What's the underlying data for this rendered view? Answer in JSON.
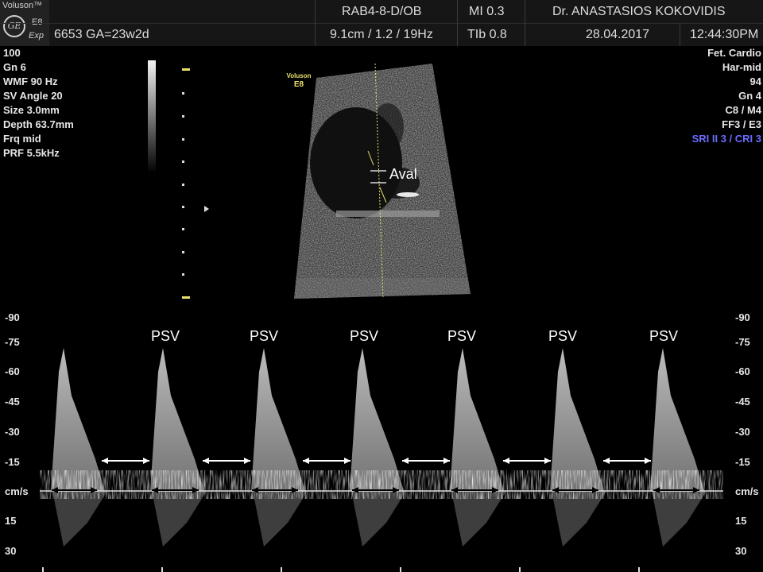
{
  "header": {
    "brand": "Voluson™",
    "model": "E8",
    "mode": "Exp",
    "probe": "RAB4-8-D/OB",
    "mi": "MI  0.3",
    "doctor": "Dr. ANASTASIOS KOKOVIDIS",
    "patient": "6653  GA=23w2d",
    "depth_freq": "9.1cm / 1.2 / 19Hz",
    "tib": "TIb  0.8",
    "date": "28.04.2017",
    "time": "12:44:30PM"
  },
  "left_params": [
    "100",
    "Gn  6",
    "WMF 90 Hz",
    "SV Angle 20",
    "Size  3.0mm",
    "Depth 63.7mm",
    "Frq mid",
    "PRF  5.5kHz"
  ],
  "right_params": [
    "Fet. Cardio",
    "Har-mid",
    "94",
    "Gn  4",
    "C8 / M4",
    "FF3 / E3"
  ],
  "right_params_highlight": "SRI II 3 / CRI 3",
  "image_labels": {
    "voluson_tag_1": "Voluson",
    "voluson_tag_2": "E8",
    "annotation": "Aval"
  },
  "spectrum": {
    "scale_labels": [
      "-90",
      "-75",
      "-60",
      "-45",
      "-30",
      "-15",
      "cm/s",
      "15",
      "30"
    ],
    "peak_label": "PSV",
    "peak_count": 6
  },
  "colors": {
    "header_bg": "#161616",
    "highlight_text": "#6b6bff",
    "marker_yellow": "#e8e06a"
  }
}
